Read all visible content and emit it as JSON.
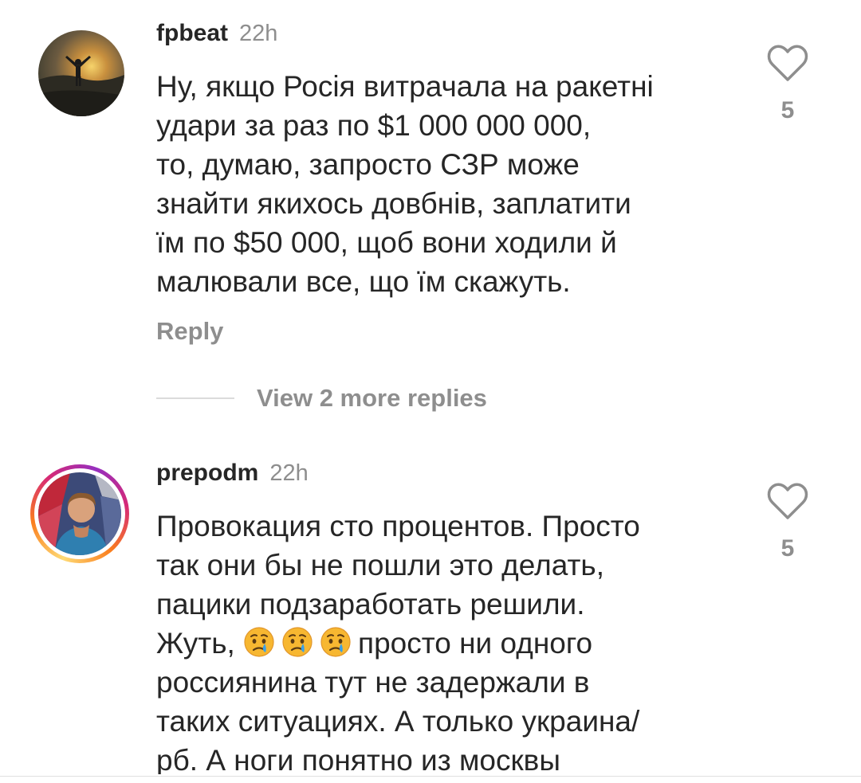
{
  "comments": [
    {
      "username": "fpbeat",
      "time": "22h",
      "text": "Ну, якщо Росія витрачала на ракетні\nудари за раз по $1 000 000 000,\nто, думаю, запросто СЗР  може\nзнайти якихось довбнів, заплатити\nїм по $50 000, щоб вони ходили й\nмалювали все, що їм скажуть.",
      "reply_label": "Reply",
      "view_more_label": "View 2 more replies",
      "likes": "5",
      "has_story": false
    },
    {
      "username": "prepodm",
      "time": "22h",
      "text_before": "Провокация сто процентов. Просто\nтак они бы не пошли это делать,\nпацики подзаработать решили.\nЖуть, ",
      "emojis": [
        "crying-face",
        "crying-face",
        "crying-face"
      ],
      "text_after": "просто ни одного\nроссиянина тут не задержали в\nтаких ситуациях. А только украина/\nрб. А ноги понятно из москвы",
      "likes": "5",
      "has_story": true
    }
  ],
  "colors": {
    "text": "#262626",
    "muted": "#8e8e8e",
    "divider": "#dbdbdb"
  }
}
